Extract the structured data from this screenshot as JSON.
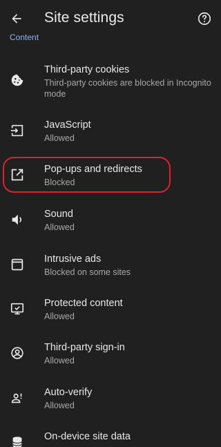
{
  "appbar": {
    "title": "Site settings",
    "back_icon": "arrow-back-icon",
    "help_icon": "help-circle-icon"
  },
  "section": {
    "header": "Content"
  },
  "items": [
    {
      "label": "Third-party cookies",
      "sub": "Third-party cookies are blocked in Incognito mode",
      "icon": "cookie-icon"
    },
    {
      "label": "JavaScript",
      "sub": "Allowed",
      "icon": "javascript-icon"
    },
    {
      "label": "Pop-ups and redirects",
      "sub": "Blocked",
      "icon": "open-in-new-icon"
    },
    {
      "label": "Sound",
      "sub": "Allowed",
      "icon": "volume-icon"
    },
    {
      "label": "Intrusive ads",
      "sub": "Blocked on some sites",
      "icon": "ads-frame-icon"
    },
    {
      "label": "Protected content",
      "sub": "Allowed",
      "icon": "protected-content-icon"
    },
    {
      "label": "Third-party sign-in",
      "sub": "Allowed",
      "icon": "account-circle-icon"
    },
    {
      "label": "Auto-verify",
      "sub": "Allowed",
      "icon": "person-alert-icon"
    },
    {
      "label": "On-device site data",
      "sub": "",
      "icon": "database-icon"
    }
  ],
  "colors": {
    "background": "#202020",
    "accent": "#8ab4f8",
    "highlight": "#d8242c"
  }
}
